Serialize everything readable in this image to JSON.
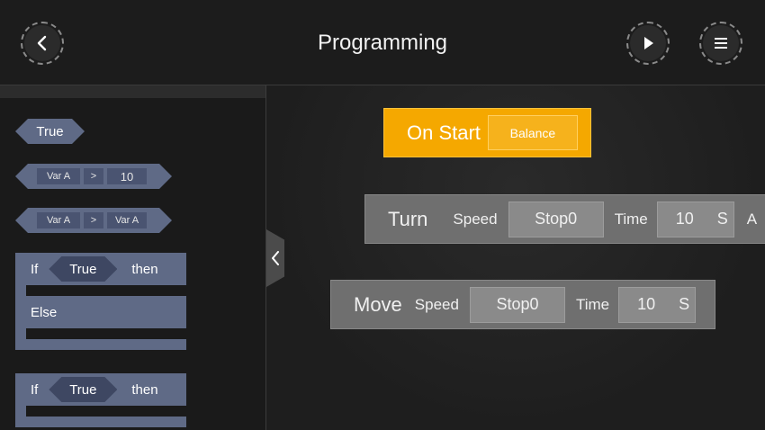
{
  "header": {
    "title": "Programming",
    "back_icon": "chevron-left-icon",
    "play_icon": "play-icon",
    "menu_icon": "menu-icon"
  },
  "palette": {
    "true_block": "True",
    "compare1": {
      "left": "Var A",
      "op": ">",
      "right": "10"
    },
    "compare2": {
      "left": "Var A",
      "op": ">",
      "right": "Var A"
    },
    "if_else": {
      "if": "If",
      "cond": "True",
      "then": "then",
      "else": "Else"
    },
    "if_block": {
      "if": "If",
      "cond": "True",
      "then": "then"
    }
  },
  "canvas": {
    "on_start": {
      "label": "On Start",
      "value": "Balance",
      "color": "#f5a800"
    },
    "turn": {
      "label": "Turn",
      "speed_label": "Speed",
      "speed": "Stop0",
      "time_label": "Time",
      "time": "10",
      "unit": "S",
      "extra": "A"
    },
    "move": {
      "label": "Move",
      "speed_label": "Speed",
      "speed": "Stop0",
      "time_label": "Time",
      "time": "10",
      "unit": "S"
    }
  }
}
